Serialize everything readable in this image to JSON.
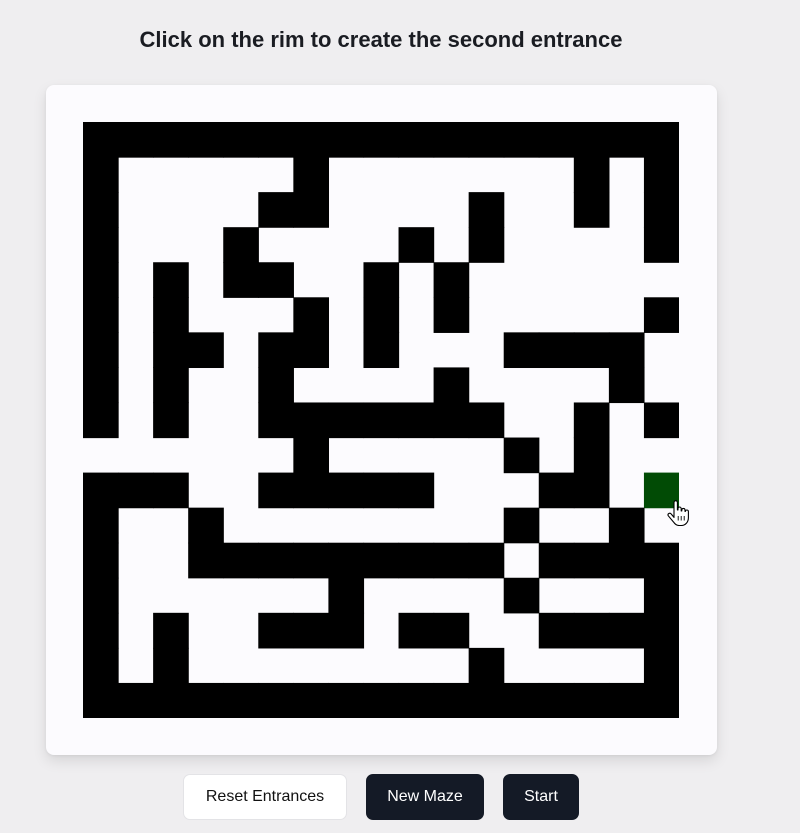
{
  "instruction": "Click on the rim to create the second entrance",
  "buttons": {
    "reset": "Reset Entrances",
    "new_maze": "New Maze",
    "start": "Start"
  },
  "colors": {
    "wall": "#000000",
    "path": "#fcfbfe",
    "entrance": "#014b05"
  },
  "maze": {
    "rows": 17,
    "cols": 17,
    "grid": [
      "#################",
      "#.....#.......#.#",
      "#....##....#..#.#",
      "#...#....#.#....#",
      "#.#.##..#.#......",
      "#.#...#.#.#.....#",
      "#.##.##.#...####.",
      "#.#..#....#....#.",
      "#.#..#######..#.#",
      "......#.....#.#..",
      "###..#####...##..",
      "#..#........#..#.",
      "#..#########.####",
      "#......#....#...#",
      "#.#..###.##..####",
      "#.#........#....#",
      "#################"
    ],
    "entrance": {
      "row": 10,
      "col": 16
    }
  },
  "cursor_icon": "hand-pointer-icon"
}
